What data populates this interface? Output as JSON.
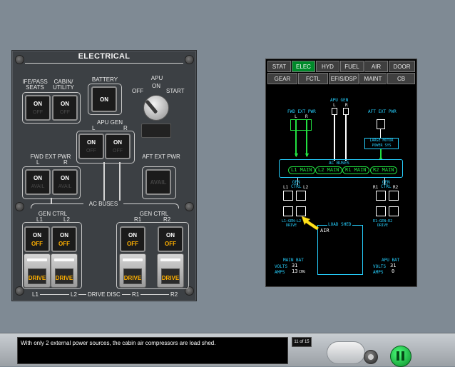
{
  "panel": {
    "title": "ELECTRICAL",
    "ife_pass_seats": "IFE/PASS\nSEATS",
    "cabin_utility": "CABIN/\nUTILITY",
    "battery": "BATTERY",
    "apu": "APU",
    "apu_off": "OFF",
    "apu_on": "ON",
    "apu_start": "START",
    "apu_gen": "APU GEN",
    "apu_gen_l": "L",
    "apu_gen_r": "R",
    "fwd_ext_pwr": "FWD EXT PWR",
    "fwd_l": "L",
    "fwd_r": "R",
    "aft_ext_pwr": "AFT EXT PWR",
    "ac_buses": "AC BUSES",
    "gen_ctrl": "GEN CTRL",
    "l1": "L1",
    "l2": "L2",
    "r1": "R1",
    "r2": "R2",
    "drive_disc": "DRIVE DISC",
    "on": "ON",
    "off": "OFF",
    "avail": "AVAIL",
    "drive": "DRIVE"
  },
  "mfd": {
    "tabs_row1": [
      "STAT",
      "ELEC",
      "HYD",
      "FUEL",
      "AIR",
      "DOOR"
    ],
    "tabs_row2": [
      "GEAR",
      "FCTL",
      "EFIS/DSP",
      "MAINT",
      "CB"
    ],
    "active_tab": "ELEC",
    "apu_gen": "APU GEN",
    "apu_l": "L",
    "apu_r": "R",
    "fwd_ext_pwr": "FWD EXT PWR",
    "fwd_l": "L",
    "fwd_r": "R",
    "aft_ext_pwr": "AFT EXT PWR",
    "large_motor": "LARGE MOTOR",
    "power_sys": "POWER SYS",
    "ac_buses": "AC BUSES",
    "buses": [
      "L1 MAIN",
      "L2 MAIN",
      "R1 MAIN",
      "R2 MAIN"
    ],
    "gen_ctrl_left": "GEN\nCTRL",
    "gen_ctrl_right": "GEN\nCTRL",
    "l1": "L1",
    "l2": "L2",
    "r1": "R1",
    "r2": "R2",
    "left_drive": "L1—GEN—L2\nDRIVE",
    "right_drive": "R1—GEN—R2\nDRIVE",
    "load_shed": "LOAD SHED",
    "air": "AIR",
    "main_bat": "MAIN BAT",
    "apu_bat": "APU BAT",
    "volts": "VOLTS",
    "amps": "AMPS",
    "main_volts": "31",
    "main_amps": "13",
    "main_amps_unit": "CHG",
    "apu_volts": "31",
    "apu_amps": "0"
  },
  "footer": {
    "message": "With only 2 external power sources, the cabin air compressors are load shed.",
    "counter": "11 of 15"
  }
}
